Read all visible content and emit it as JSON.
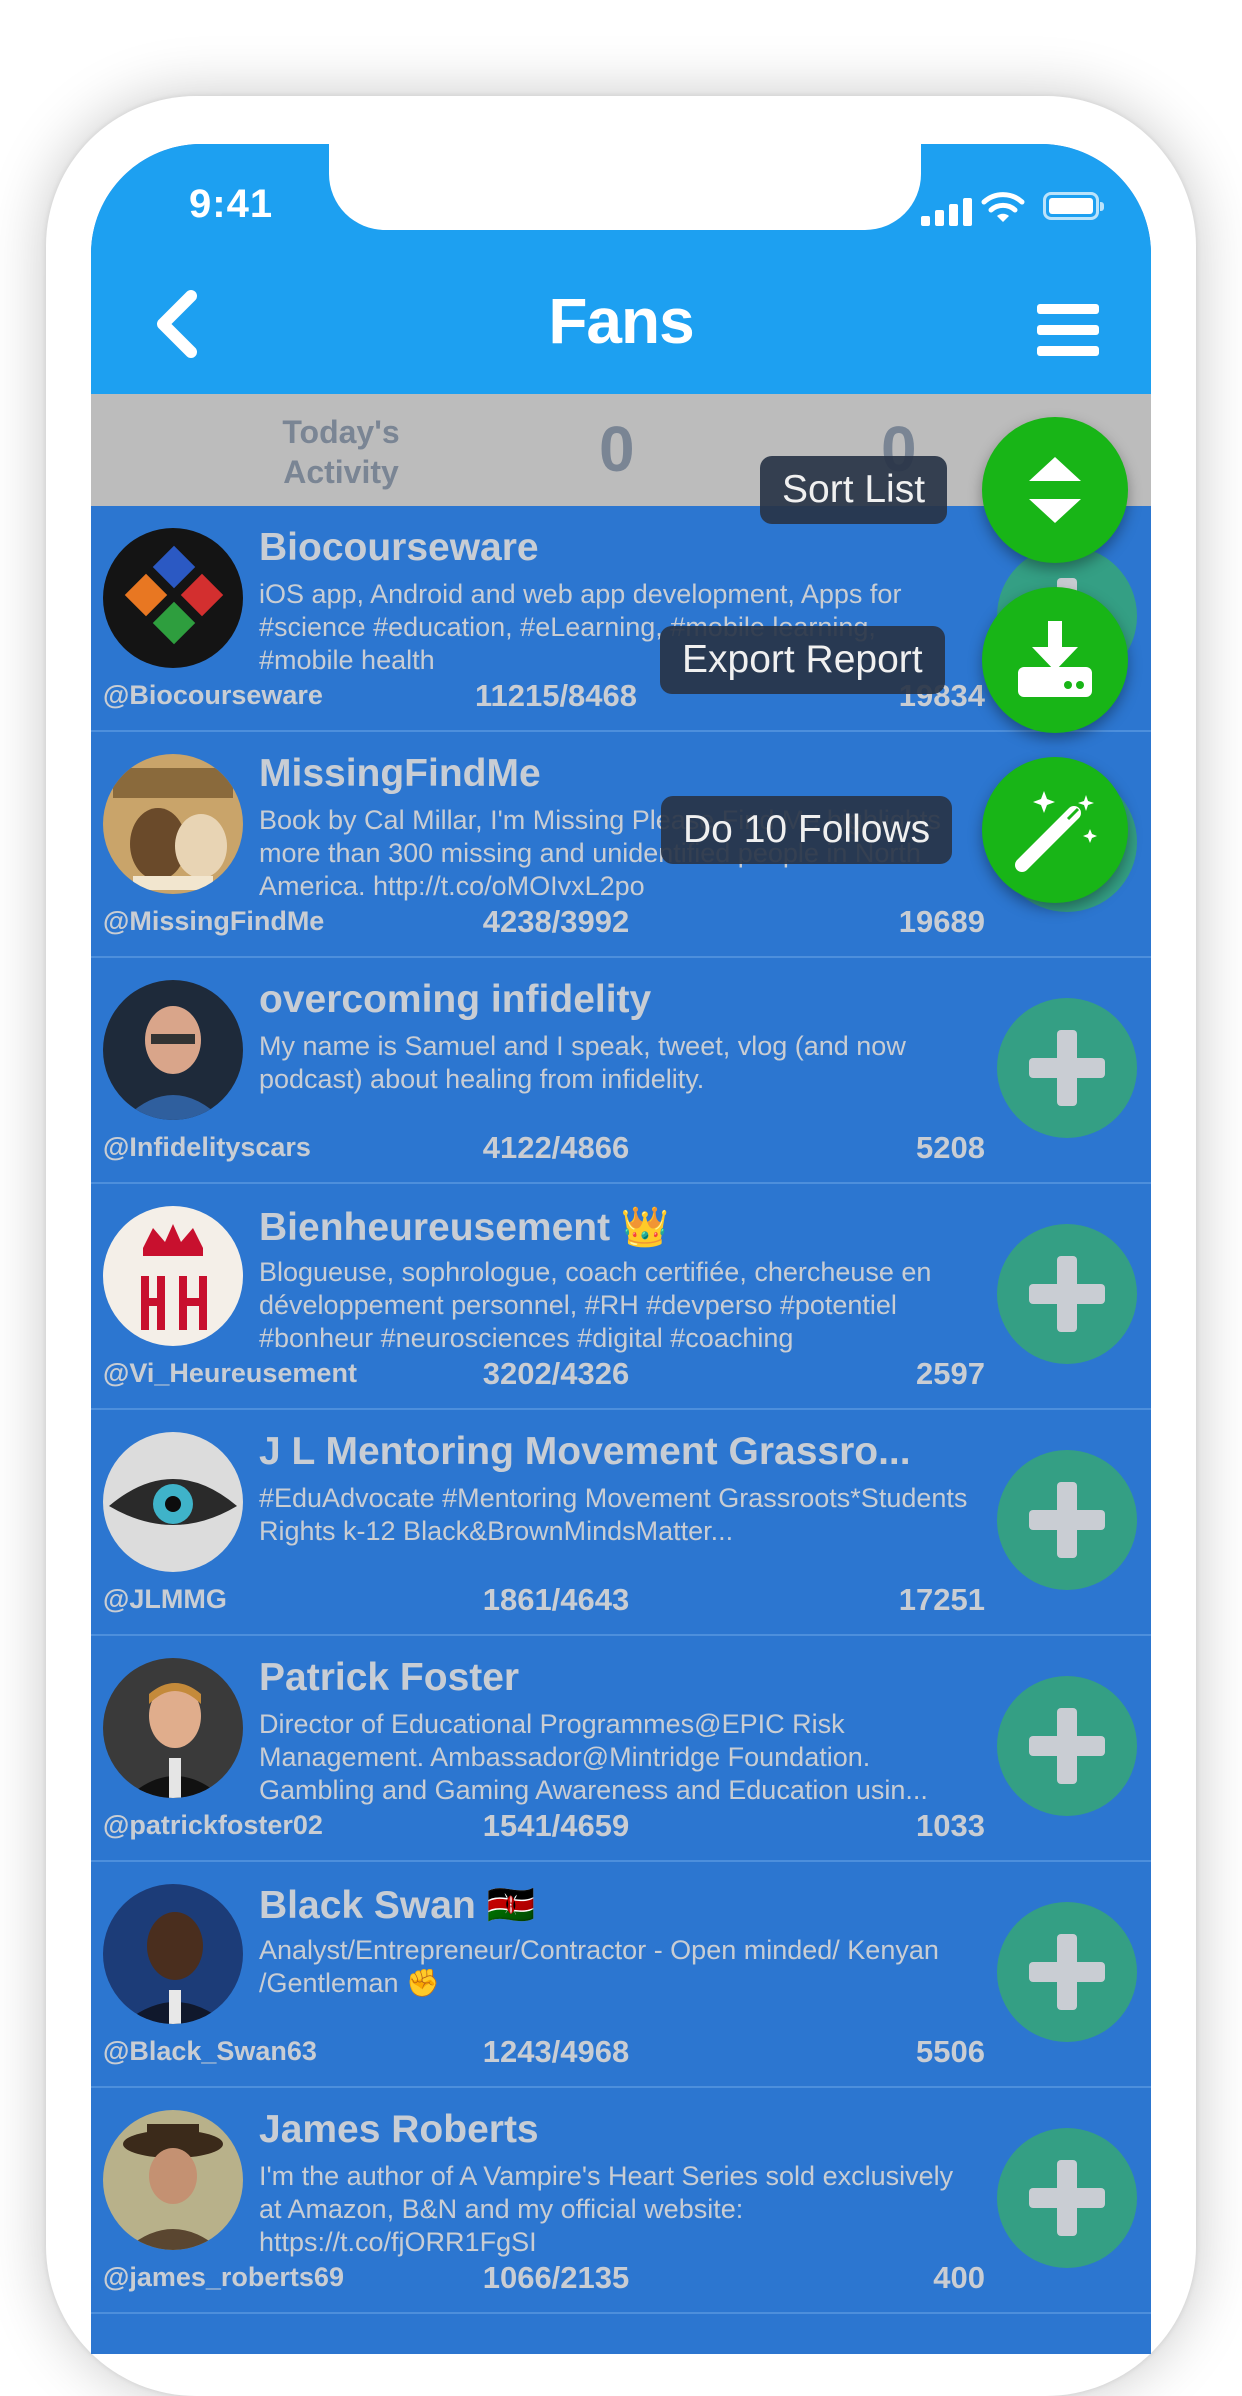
{
  "status_bar": {
    "time": "9:41"
  },
  "header": {
    "title": "Fans"
  },
  "activity": {
    "label": "Today's Activity",
    "value_left": "0",
    "value_right": "0"
  },
  "actions": [
    {
      "label": "Sort List",
      "icon": "sort-arrows-icon"
    },
    {
      "label": "Export Report",
      "icon": "download-icon"
    },
    {
      "label": "Do 10 Follows",
      "icon": "magic-wand-icon"
    }
  ],
  "fans": [
    {
      "name": "Biocourseware",
      "bio": "iOS app, Android and web app development, Apps for #science #education, #eLearning, #mobile learning, #mobile health",
      "handle": "@Biocourseware",
      "ratio": "11215/8468",
      "count": "19834"
    },
    {
      "name": "MissingFindMe",
      "bio": "Book by Cal Millar, I'm Missing Please Find Me highlights more than 300 missing and unidentified people in North America. http://t.co/oMOIvxL2po",
      "handle": "@MissingFindMe",
      "ratio": "4238/3992",
      "count": "19689"
    },
    {
      "name": "overcoming infidelity",
      "bio": "My name is Samuel and I speak, tweet, vlog (and now podcast) about healing from infidelity.",
      "handle": "@Infidelityscars",
      "ratio": "4122/4866",
      "count": "5208"
    },
    {
      "name": "Bienheureusement 👑",
      "bio": "Blogueuse, sophrologue, coach certifiée, chercheuse en développement personnel, #RH #devperso #potentiel #bonheur #neurosciences #digital #coaching",
      "handle": "@Vi_Heureusement",
      "ratio": "3202/4326",
      "count": "2597"
    },
    {
      "name": "J L Mentoring Movement Grassro...",
      "bio": "#EduAdvocate #Mentoring Movement Grassroots*Students Rights k-12 Black&BrownMindsMatter...",
      "handle": "@JLMMG",
      "ratio": "1861/4643",
      "count": "17251"
    },
    {
      "name": "Patrick Foster",
      "bio": "Director of Educational Programmes@EPIC Risk Management. Ambassador@Mintridge Foundation. Gambling and Gaming Awareness and Education usin...",
      "handle": "@patrickfoster02",
      "ratio": "1541/4659",
      "count": "1033"
    },
    {
      "name": "Black Swan 🇰🇪",
      "bio": "Analyst/Entrepreneur/Contractor - Open minded/ Kenyan /Gentleman ✊",
      "handle": "@Black_Swan63",
      "ratio": "1243/4968",
      "count": "5506"
    },
    {
      "name": "James Roberts",
      "bio": "I'm the author of A Vampire's Heart Series sold exclusively at Amazon, B&N and my official website: https://t.co/fjORR1FgSI",
      "handle": "@james_roberts69",
      "ratio": "1066/2135",
      "count": "400"
    }
  ],
  "colors": {
    "header": "#1da0f1",
    "list_bg": "#2c76d0",
    "fab": "#18b517",
    "add_button": "#349f84",
    "activity_bar": "#bcbcbc"
  }
}
